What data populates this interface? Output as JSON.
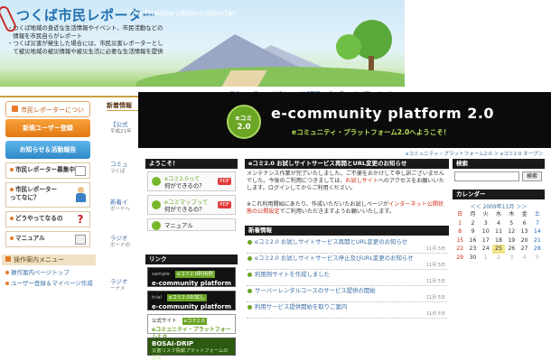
{
  "back": {
    "banner": {
      "title": "つくば市民レポーター",
      "subtitle": "The Tsukuba citizens reporter",
      "bullets": [
        "・つくば地域の身近な生活情報やイベント、市民活動などの",
        "　情報を市民自らがレポート",
        "・つくば災害が発生した場合には、市民災害レポーターとし",
        "　て被災地域の被災情報や被災生活に必要な生活情報を提供"
      ]
    },
    "breadcrumb": "eコミュニティつくば ＞ つくば市民レポーター オープンページ",
    "sidebar": {
      "about": "市民レポーターについて",
      "register": "新規ユーザー登録",
      "news": "お知らせ＆活動報告",
      "cards": [
        "市民レポーター募集中",
        "市民レポーター\nってなに？",
        "どうやってなるの",
        "マニュアル"
      ],
      "menu_head": "操作案内メニュー",
      "menu_links": [
        "操作案内ページトップ",
        "ユーザー登録＆マイページ作成"
      ]
    },
    "center": {
      "head": "新着情報",
      "items": [
        "【公式",
        "コミュ",
        "新着イ",
        "ラジオ",
        "ラジオ"
      ],
      "texts": [
        "平成21年",
        "つくば",
        "ボードへ",
        "ボードの",
        "ーナメ"
      ]
    }
  },
  "front": {
    "header": {
      "logo_top": "eコミ",
      "logo_bottom": "2.0",
      "title": "e-community platform 2.0",
      "subtitle": "eコミュニティ・プラットフォーム2.0へようこそ！"
    },
    "breadcrumb": "eコミュニティ・プラットフォーム2.0 ＞ eコミ2.0 オープン",
    "left": {
      "welcome_head": "ようこそ！",
      "buttons": [
        {
          "title": "eコミ2.0って",
          "sub": "何ができるの？",
          "pdf": "PDF"
        },
        {
          "title": "eコミマップって",
          "sub": "何ができるの？",
          "pdf": "PDF"
        },
        {
          "title": "マニュアル",
          "sub": "",
          "pdf": ""
        }
      ],
      "links_head": "リンク",
      "banners": [
        {
          "tag": "sample",
          "tag2": "eコミ2.0利用例",
          "big": "e-community platform 2.0"
        },
        {
          "tag": "trial",
          "tag2": "eコミ2.0お試し",
          "big": "e-community platform 2.0"
        },
        {
          "tag": "公式サイト",
          "tag2": "eコミ2.0",
          "big": "eコミュニティ・プラットフォーム2.0"
        },
        {
          "tag": "",
          "tag2": "",
          "big": "BOSAI-DRIP",
          "small": "災害リスク情報プラットフォームの開発"
        }
      ]
    },
    "main": {
      "notice_head": "eコミ2.0 お試しサイトサービス再開とURL変更のお知らせ",
      "notice_body_1": "メンテナンス作業が完了いたしました。ご不便をおかけして申し訳ございませ",
      "notice_body_2": "んでした。今後のご利用につきましては、",
      "notice_hl": "お試しサイト",
      "notice_body_3": "へのアクセスをお願いいた",
      "notice_body_4": "します。ログインしてからご利用ください。",
      "notice2_body_1": "※これ利用開始にあたり、作成いただいたお試しページが",
      "notice2_hl": "インターネット公開状",
      "notice2_body_2": "態の公開設定",
      "notice2_body_3": "でご利用いただきますようお願いいたします。",
      "news_head": "新着情報",
      "news": [
        {
          "title": "eコミ2.0 お試しサイトサービス再開とURL変更のお知らせ",
          "date": "11月 5日"
        },
        {
          "title": "eコミ2.0 お試しサイトサービス停止及びURL変更のお知らせ",
          "date": "11月 5日"
        },
        {
          "title": "利用例サイトを作成しました",
          "date": "11月 5日"
        },
        {
          "title": "サーバーレンタルコースのサービス提供の開始",
          "date": "11月 5日"
        },
        {
          "title": "利用サービス提供開始を取りご案内",
          "date": "11月 5日"
        }
      ]
    },
    "right": {
      "search_head": "検索",
      "search_placeholder": "",
      "search_button": "検索",
      "calendar_head": "カレンダー",
      "calendar_nav": "＜＜ 2009年11月 ＞＞",
      "weekdays": [
        "日",
        "月",
        "火",
        "水",
        "木",
        "金",
        "土"
      ],
      "weeks": [
        [
          "1",
          "2",
          "3",
          "4",
          "5",
          "6",
          "7"
        ],
        [
          "8",
          "9",
          "10",
          "11",
          "12",
          "13",
          "14"
        ],
        [
          "15",
          "16",
          "17",
          "18",
          "19",
          "20",
          "21"
        ],
        [
          "22",
          "23",
          "24",
          "25",
          "26",
          "27",
          "28"
        ],
        [
          "29",
          "30",
          "1",
          "2",
          "3",
          "4",
          "5"
        ]
      ],
      "today": "25"
    }
  }
}
